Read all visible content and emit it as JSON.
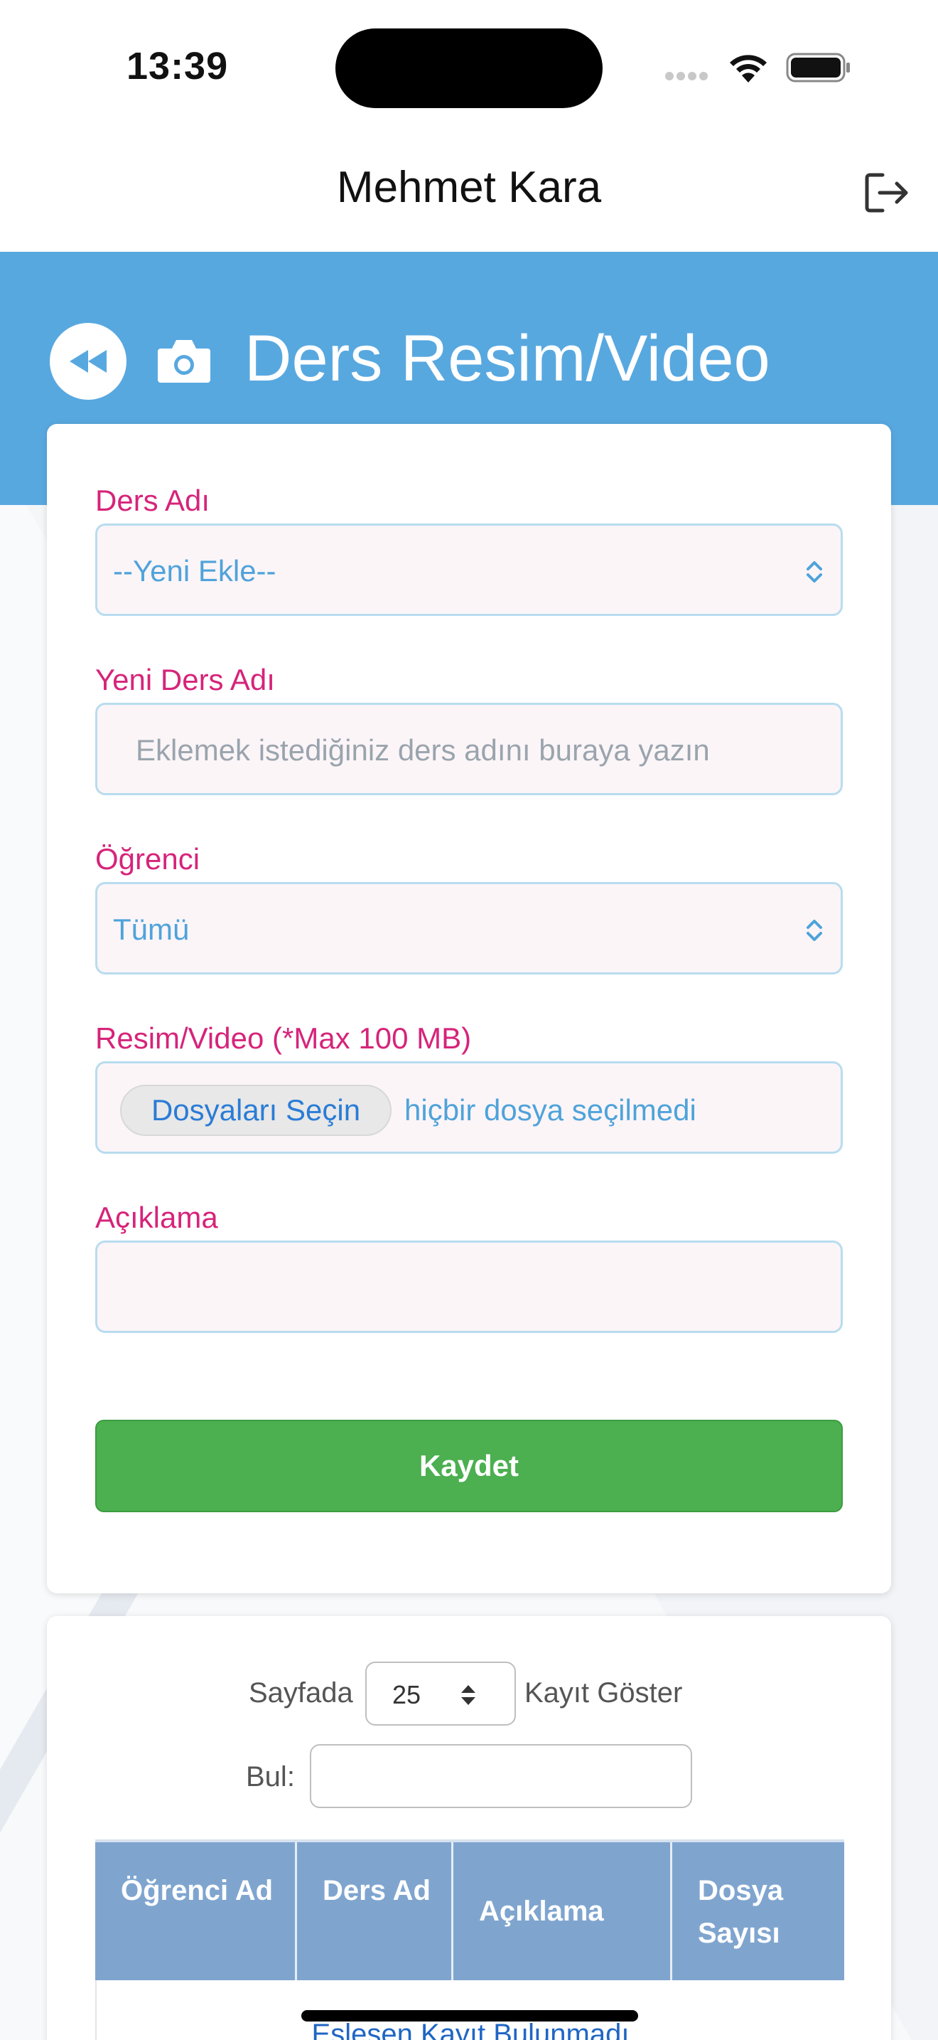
{
  "status_bar": {
    "time": "13:39"
  },
  "nav": {
    "title": "Mehmet Kara"
  },
  "header": {
    "title": "Ders Resim/Video"
  },
  "form": {
    "course_label": "Ders Adı",
    "course_value": "--Yeni Ekle--",
    "new_course_label": "Yeni Ders Adı",
    "new_course_placeholder": "Eklemek istediğiniz ders adını buraya yazın",
    "student_label": "Öğrenci",
    "student_value": "Tümü",
    "media_label": "Resim/Video (*Max 100 MB)",
    "file_button": "Dosyaları Seçin",
    "file_status": "hiçbir dosya seçilmedi",
    "description_label": "Açıklama",
    "description_value": "",
    "save_button": "Kaydet"
  },
  "list": {
    "length_pre": "Sayfada",
    "length_value": "25",
    "length_post": "Kayıt Göster",
    "search_label": "Bul:",
    "search_value": "",
    "columns": [
      "Öğrenci Ad",
      "Ders Ad",
      "Açıklama",
      "Dosya Sayısı"
    ],
    "empty_message": "Eşleşen Kayıt Bulunmadı"
  },
  "colors": {
    "header_band": "#58a8e0",
    "label_pink": "#d6247a",
    "save_green": "#4caf50",
    "table_header": "#7fa5cf"
  }
}
